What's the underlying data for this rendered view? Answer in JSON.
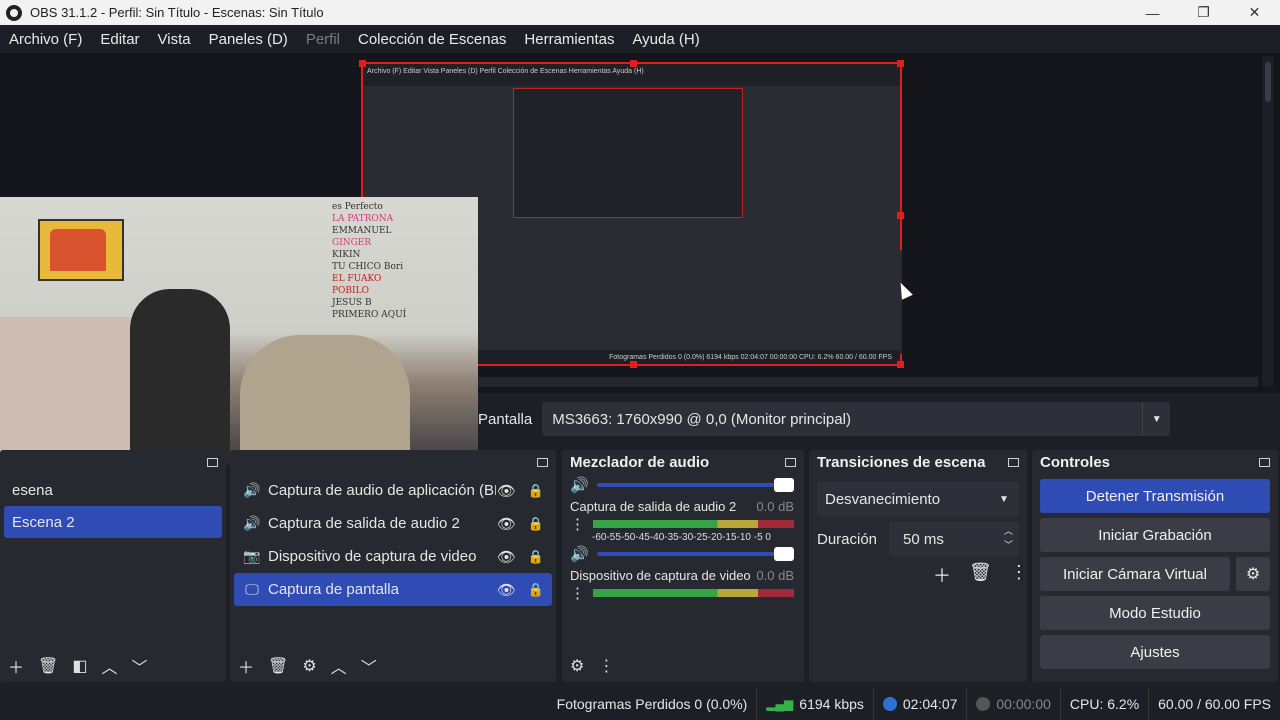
{
  "window": {
    "title": "OBS 31.1.2 - Perfil: Sin Título - Escenas: Sin Título"
  },
  "window_controls": {
    "minimize": "—",
    "maximize": "❐",
    "close": "✕"
  },
  "menu": [
    "Archivo (F)",
    "Editar",
    "Vista",
    "Paneles (D)",
    "Perfil",
    "Colección de Escenas",
    "Herramientas",
    "Ayuda (H)"
  ],
  "overlay_names": [
    "es Perfecto",
    "LA PATRONA",
    "EMMANUEL",
    "GINGER",
    "KIKIN",
    "TU CHICO Bori",
    "EL FUAKO",
    "POBILO",
    "JESUS B",
    "PRIMERO AQUÍ"
  ],
  "source_bar": {
    "label": "Pantalla",
    "value": "MS3663: 1760x990 @ 0,0 (Monitor principal)"
  },
  "scenes": {
    "items": [
      "esena",
      "Escena 2"
    ],
    "selected": 1
  },
  "sources": {
    "items": [
      {
        "icon": "speaker-icon",
        "glyph": "🔊",
        "label": "Captura de audio de aplicación (BETA)"
      },
      {
        "icon": "speaker-icon",
        "glyph": "🔊",
        "label": "Captura de salida de audio 2"
      },
      {
        "icon": "camera-icon",
        "glyph": "📷",
        "label": "Dispositivo de captura de video"
      },
      {
        "icon": "monitor-icon",
        "glyph": "🖵",
        "label": "Captura de pantalla"
      }
    ],
    "selected": 3
  },
  "mixer": {
    "title": "Mezclador de audio",
    "scale": "-60-55-50-45-40-35-30-25-20-15-10 -5 0",
    "channels": [
      {
        "name": "Captura de salida de audio 2",
        "db": "0.0 dB"
      },
      {
        "name": "Dispositivo de captura de video",
        "db": "0.0 dB"
      }
    ]
  },
  "transitions": {
    "title": "Transiciones de escena",
    "selected": "Desvanecimiento",
    "duration_label": "Duración",
    "duration_value": "50 ms"
  },
  "controls": {
    "title": "Controles",
    "stop_stream": "Detener Transmisión",
    "start_recording": "Iniciar Grabación",
    "virtual_cam": "Iniciar Cámara Virtual",
    "studio_mode": "Modo Estudio",
    "settings": "Ajustes"
  },
  "status": {
    "dropped": "Fotogramas Perdidos 0 (0.0%)",
    "bitrate": "6194 kbps",
    "stream_time": "02:04:07",
    "rec_time": "00:00:00",
    "cpu": "CPU: 6.2%",
    "fps": "60.00 / 60.00 FPS",
    "colors": {
      "live": "#2f6fd6",
      "rec_idle": "#555555",
      "signal": "#39b14a"
    }
  },
  "inner_capture": {
    "menu": "Archivo (F)  Editar  Vista  Paneles (D)  Perfil  Colección de Escenas  Herramientas  Ayuda (H)",
    "status": "Fotogramas Perdidos 0 (0.0%)   6194 kbps   02:04:07   00:00:00   CPU: 6.2%   60.00 / 60.00 FPS"
  }
}
